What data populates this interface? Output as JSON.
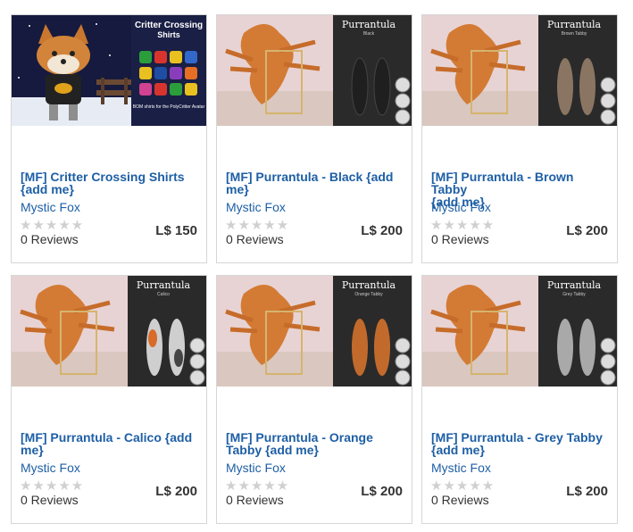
{
  "currency": "L$",
  "products": [
    {
      "title": "[MF] Critter Crossing Shirts",
      "title_line2": "{add me}",
      "seller": "Mystic Fox",
      "rating": 0,
      "reviews": "0 Reviews",
      "price": "L$ 150",
      "image_title": "Critter Crossing",
      "image_title2": "Shirts",
      "image_note": "BOM shirts for the PolyCritter Avatar",
      "variant": "critter"
    },
    {
      "title": "[MF] Purrantula - Black {add",
      "title_line2": "me}",
      "seller": "Mystic Fox",
      "rating": 0,
      "reviews": "0 Reviews",
      "price": "L$ 200",
      "image_title": "Purrantula",
      "image_sub": "Black",
      "variant": "black",
      "color": "#1f1f1f"
    },
    {
      "title": "[MF] Purrantula - Brown Tabby",
      "title_line2": "{add me}",
      "seller": "Mystic Fox",
      "rating": 0,
      "reviews": "0 Reviews",
      "price": "L$ 200",
      "image_title": "Purrantula",
      "image_sub": "Brown Tabby",
      "variant": "brown",
      "color": "#8a7563"
    },
    {
      "title": "[MF] Purrantula - Calico {add",
      "title_line2": "me}",
      "seller": "Mystic Fox",
      "rating": 0,
      "reviews": "0 Reviews",
      "price": "L$ 200",
      "image_title": "Purrantula",
      "image_sub": "Calico",
      "variant": "calico",
      "color": "#cfcfcf"
    },
    {
      "title": "[MF] Purrantula - Orange",
      "title_line2": "Tabby {add me}",
      "seller": "Mystic Fox",
      "rating": 0,
      "reviews": "0 Reviews",
      "price": "L$ 200",
      "image_title": "Purrantula",
      "image_sub": "Orange Tabby",
      "variant": "orange",
      "color": "#c26a2c"
    },
    {
      "title": "[MF] Purrantula - Grey Tabby",
      "title_line2": "{add me}",
      "seller": "Mystic Fox",
      "rating": 0,
      "reviews": "0 Reviews",
      "price": "L$ 200",
      "image_title": "Purrantula",
      "image_sub": "Grey Tabby",
      "variant": "grey",
      "color": "#a9a9a9"
    }
  ]
}
